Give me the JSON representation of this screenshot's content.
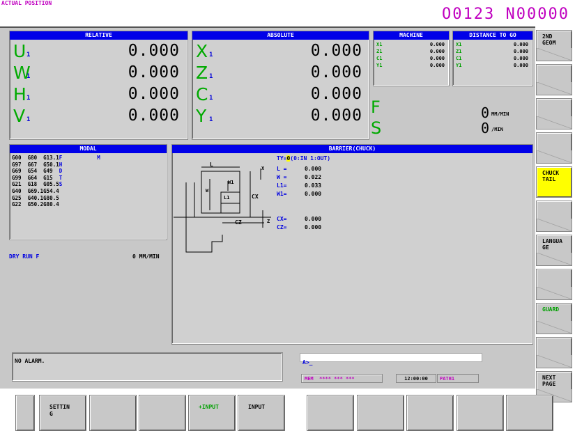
{
  "screen_title": "ACTUAL POSITION",
  "program_number": "O0123 N00000",
  "relative": {
    "header": "RELATIVE",
    "axes": [
      {
        "name": "U",
        "sub": "1",
        "value": "0.000"
      },
      {
        "name": "W",
        "sub": "1",
        "value": "0.000"
      },
      {
        "name": "H",
        "sub": "1",
        "value": "0.000"
      },
      {
        "name": "V",
        "sub": "1",
        "value": "0.000"
      }
    ]
  },
  "absolute": {
    "header": "ABSOLUTE",
    "axes": [
      {
        "name": "X",
        "sub": "1",
        "value": "0.000"
      },
      {
        "name": "Z",
        "sub": "1",
        "value": "0.000"
      },
      {
        "name": "C",
        "sub": "1",
        "value": "0.000"
      },
      {
        "name": "Y",
        "sub": "1",
        "value": "0.000"
      }
    ]
  },
  "machine": {
    "header": "MACHINE",
    "rows": [
      {
        "axis": "X1",
        "value": "0.000"
      },
      {
        "axis": "Z1",
        "value": "0.000"
      },
      {
        "axis": "C1",
        "value": "0.000"
      },
      {
        "axis": "Y1",
        "value": "0.000"
      }
    ]
  },
  "distance_to_go": {
    "header": "DISTANCE TO GO",
    "rows": [
      {
        "axis": "X1",
        "value": "0.000"
      },
      {
        "axis": "Z1",
        "value": "0.000"
      },
      {
        "axis": "C1",
        "value": "0.000"
      },
      {
        "axis": "Y1",
        "value": "0.000"
      }
    ]
  },
  "feed": {
    "label": "F",
    "value": "0",
    "unit": "MM/MIN"
  },
  "spindle": {
    "label": "S",
    "value": "0",
    "unit": "/MIN"
  },
  "modal": {
    "header": "MODAL",
    "rows": [
      {
        "text": "G00  G80  G13.1",
        "blue": "F",
        "extra": "M"
      },
      {
        "text": "G97  G67  G50.1",
        "blue": "H",
        "extra": ""
      },
      {
        "text": "G69  G54  G49  ",
        "blue": "D",
        "extra": ""
      },
      {
        "text": "G99  G64  G15  ",
        "blue": "T",
        "extra": ""
      },
      {
        "text": "G21  G18  G05.5",
        "blue": "S",
        "extra": ""
      },
      {
        "text": "G40  G69.1G54.4",
        "blue": "",
        "extra": ""
      },
      {
        "text": "G25  G40.1G80.5",
        "blue": "",
        "extra": ""
      },
      {
        "text": "G22  G50.2G80.4",
        "blue": "",
        "extra": ""
      }
    ]
  },
  "dry_run": {
    "label": "DRY RUN F",
    "value": "0 MM/MIN"
  },
  "barrier": {
    "header": "BARRIER(CHUCK)",
    "ty_prefix": "TY=",
    "ty_value": "0",
    "ty_suffix": "(0:IN 1:OUT)",
    "params": [
      {
        "name": "L =",
        "value": "0.000"
      },
      {
        "name": "W =",
        "value": "0.022"
      },
      {
        "name": "L1=",
        "value": "0.033"
      },
      {
        "name": "W1=",
        "value": "0.000"
      }
    ],
    "params2": [
      {
        "name": "CX=",
        "value": "0.000"
      },
      {
        "name": "CZ=",
        "value": "0.000"
      }
    ],
    "diagram_labels": {
      "L": "L",
      "W": "W",
      "W1": "W1",
      "L1": "L1",
      "CX": "CX",
      "CZ": "CZ",
      "X": "X",
      "Z": "Z"
    }
  },
  "alarm": "NO ALARM.",
  "input_prompt": "A>_",
  "status": {
    "mode": "MEM  **** *** ***",
    "time": "12:00:00",
    "path": "PATH1"
  },
  "right_softkeys": [
    {
      "label": "2ND\nGEOM",
      "highlight": false,
      "green": false
    },
    {
      "label": "",
      "highlight": false,
      "green": false
    },
    {
      "label": "",
      "highlight": false,
      "green": false
    },
    {
      "label": "",
      "highlight": false,
      "green": false
    },
    {
      "label": "CHUCK\nTAIL",
      "highlight": true,
      "green": false
    },
    {
      "label": "",
      "highlight": false,
      "green": false
    },
    {
      "label": "LANGUA\nGE",
      "highlight": false,
      "green": false
    },
    {
      "label": "",
      "highlight": false,
      "green": false
    },
    {
      "label": "GUARD",
      "highlight": false,
      "green": true
    },
    {
      "label": "",
      "highlight": false,
      "green": false
    },
    {
      "label": "NEXT\nPAGE",
      "highlight": false,
      "green": false
    }
  ],
  "bottom_softkeys": [
    {
      "label": "",
      "green": false
    },
    {
      "label": "SETTIN\nG",
      "green": false
    },
    {
      "label": "",
      "green": false
    },
    {
      "label": "",
      "green": false
    },
    {
      "label": "+INPUT",
      "green": true
    },
    {
      "label": "INPUT",
      "green": false
    },
    {
      "label": "",
      "green": false
    },
    {
      "label": "",
      "green": false
    },
    {
      "label": "",
      "green": false
    },
    {
      "label": "",
      "green": false
    },
    {
      "label": "",
      "green": false
    }
  ],
  "colors": {
    "header_blue": "#0000e8",
    "axis_green": "#00aa00",
    "magenta": "#c000c0",
    "highlight_yellow": "#ffff00"
  }
}
